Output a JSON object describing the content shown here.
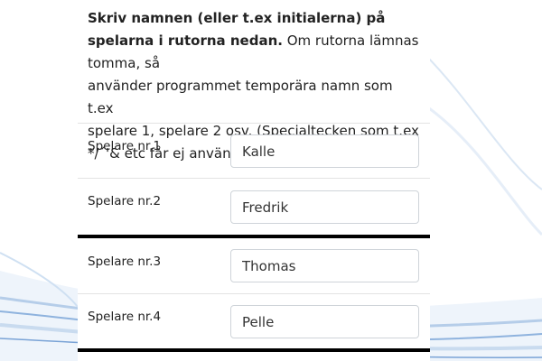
{
  "instructions": {
    "bold": "Skriv namnen (eller t.ex initialerna) på spelarna i rutorna nedan.",
    "line1_rest": " Om rutorna lämnas tomma, så",
    "line2": "använder programmet temporära namn som t.ex",
    "line3": "spelare 1, spelare 2 osv. (Specialtecken som t.ex",
    "line4": "*/´'& etc får ej användas i namnet.)"
  },
  "players": [
    {
      "label": "Spelare nr.1",
      "value": "Kalle"
    },
    {
      "label": "Spelare nr.2",
      "value": "Fredrik"
    },
    {
      "label": "Spelare nr.3",
      "value": "Thomas"
    },
    {
      "label": "Spelare nr.4",
      "value": "Pelle"
    }
  ]
}
